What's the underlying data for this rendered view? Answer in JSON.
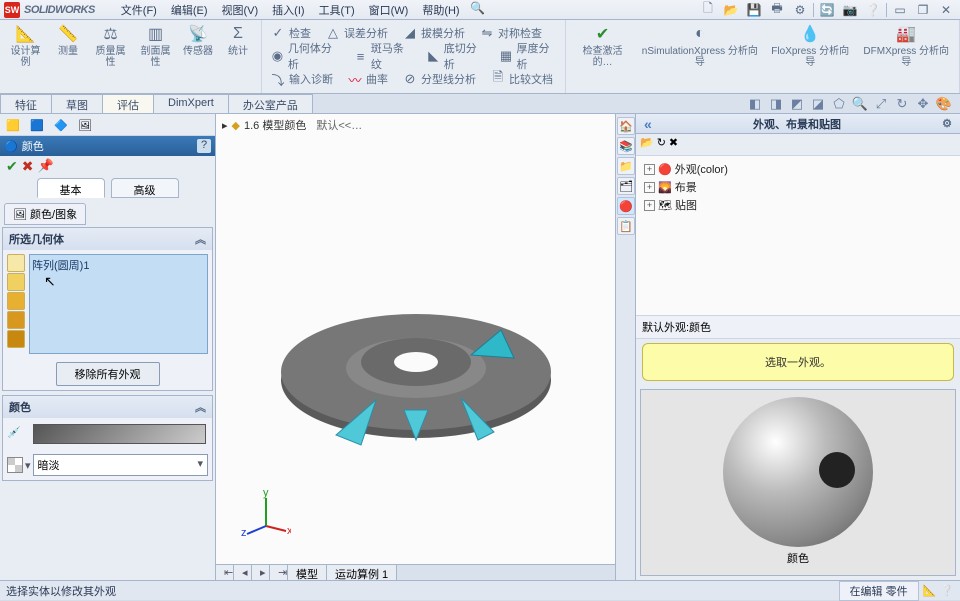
{
  "app": {
    "logo": "SW",
    "name": "SOLIDWORKS"
  },
  "menu": [
    "文件(F)",
    "编辑(E)",
    "视图(V)",
    "插入(I)",
    "工具(T)",
    "窗口(W)",
    "帮助(H)"
  ],
  "ribbon": {
    "g1": [
      {
        "label": "设计算例",
        "icon": "📐"
      },
      {
        "label": "测量",
        "icon": "📏"
      },
      {
        "label": "质量属性",
        "icon": "⚖"
      },
      {
        "label": "剖面属性",
        "icon": "▥"
      },
      {
        "label": "传感器",
        "icon": "📡"
      },
      {
        "label": "统计",
        "icon": "Σ"
      }
    ],
    "g2top": [
      {
        "label": "检查",
        "icon": "✓"
      },
      {
        "label": "误差分析",
        "icon": "△"
      },
      {
        "label": "拔模分析",
        "icon": "◢"
      },
      {
        "label": "对称检查",
        "icon": "⇋"
      }
    ],
    "g2mid": [
      {
        "label": "几何体分析",
        "icon": "◉"
      },
      {
        "label": "斑马条纹",
        "icon": "≡"
      },
      {
        "label": "底切分析",
        "icon": "◣"
      },
      {
        "label": "厚度分析",
        "icon": "▦"
      }
    ],
    "g2bot": [
      {
        "label": "输入诊断",
        "icon": "⤵"
      },
      {
        "label": "曲率",
        "icon": "〰"
      },
      {
        "label": "分型线分析",
        "icon": "⊘"
      },
      {
        "label": "比较文档",
        "icon": "🗎"
      }
    ],
    "g3": [
      {
        "label": "检查激活的…",
        "icon": "✔"
      },
      {
        "label": "nSimulationXpress 分析向导",
        "icon": "◐"
      },
      {
        "label": "FloXpress 分析向导",
        "icon": "💧"
      },
      {
        "label": "DFMXpress 分析向导",
        "icon": "🏭"
      }
    ]
  },
  "tabs": [
    "特征",
    "草图",
    "评估",
    "DimXpert",
    "办公室产品"
  ],
  "tabs_active": 2,
  "canvas": {
    "header_icon": "◆",
    "header_text": "1.6 模型颜色",
    "header_sub": "默认<<…"
  },
  "pm": {
    "title": "颜色",
    "basic": "基本",
    "adv": "高级",
    "subtab": "颜色/图象",
    "sec_sel": "所选几何体",
    "sel_item": "阵列(圆周)1",
    "remove": "移除所有外观",
    "sec_color": "颜色",
    "preset": "暗淡"
  },
  "rp": {
    "title": "外观、布景和贴图",
    "tree": [
      {
        "icon": "🔴",
        "label": "外观(color)"
      },
      {
        "icon": "🌄",
        "label": "布景"
      },
      {
        "icon": "🗺",
        "label": "贴图"
      }
    ],
    "defapp": "默认外观:颜色",
    "pick": "选取一外观。",
    "thumb_label": "颜色"
  },
  "bottom_tabs": [
    "模型",
    "运动算例 1"
  ],
  "status": {
    "left": "选择实体以修改其外观",
    "right": "在编辑 零件"
  }
}
